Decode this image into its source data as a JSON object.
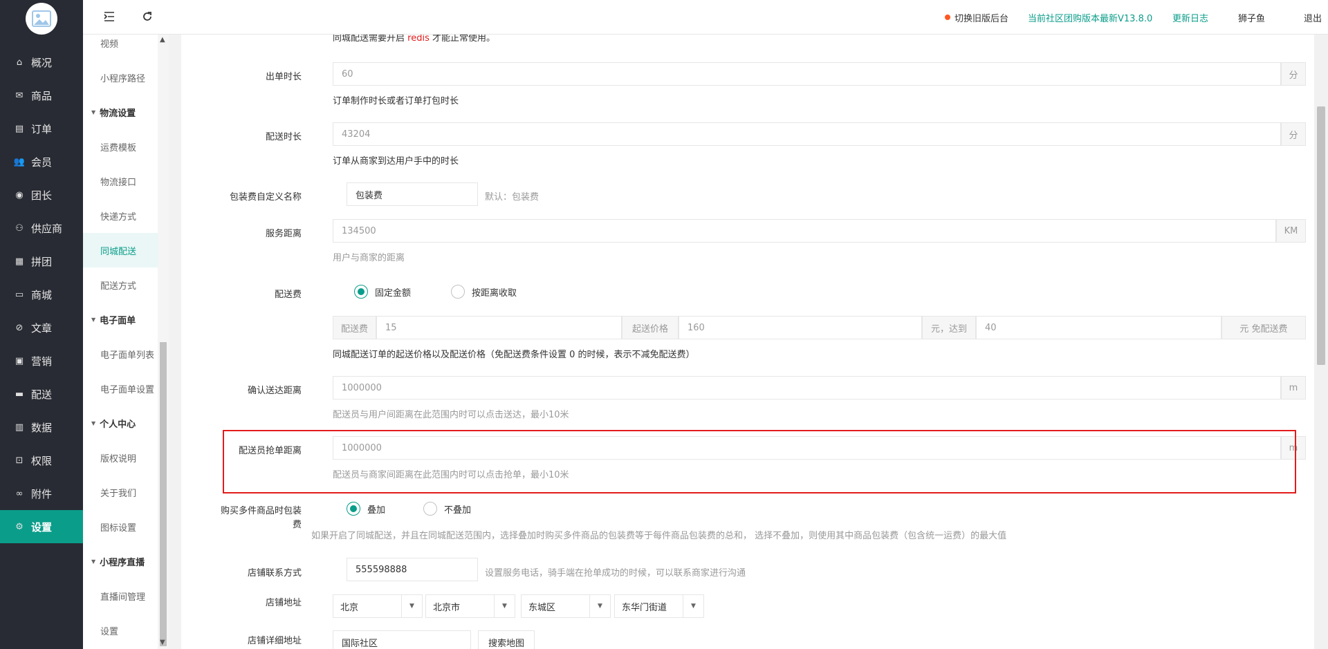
{
  "sidebar": {
    "items": [
      {
        "label": "概况",
        "icon": "home-icon"
      },
      {
        "label": "商品",
        "icon": "envelope-icon"
      },
      {
        "label": "订单",
        "icon": "file-icon"
      },
      {
        "label": "会员",
        "icon": "users-icon"
      },
      {
        "label": "团长",
        "icon": "leader-icon"
      },
      {
        "label": "供应商",
        "icon": "supplier-icon"
      },
      {
        "label": "拼团",
        "icon": "group-icon"
      },
      {
        "label": "商城",
        "icon": "store-icon"
      },
      {
        "label": "文章",
        "icon": "compass-icon"
      },
      {
        "label": "营销",
        "icon": "gift-icon"
      },
      {
        "label": "配送",
        "icon": "truck-icon"
      },
      {
        "label": "数据",
        "icon": "chart-icon"
      },
      {
        "label": "权限",
        "icon": "lock-icon"
      },
      {
        "label": "附件",
        "icon": "link-icon"
      },
      {
        "label": "设置",
        "icon": "gear-icon"
      }
    ],
    "active": "设置"
  },
  "submenu": {
    "items": [
      {
        "label": "视频",
        "type": "item"
      },
      {
        "label": "小程序路径",
        "type": "item"
      },
      {
        "label": "物流设置",
        "type": "group"
      },
      {
        "label": "运费模板",
        "type": "item"
      },
      {
        "label": "物流接口",
        "type": "item"
      },
      {
        "label": "快递方式",
        "type": "item"
      },
      {
        "label": "同城配送",
        "type": "item",
        "active": true
      },
      {
        "label": "配送方式",
        "type": "item"
      },
      {
        "label": "电子面单",
        "type": "group"
      },
      {
        "label": "电子面单列表",
        "type": "item"
      },
      {
        "label": "电子面单设置",
        "type": "item"
      },
      {
        "label": "个人中心",
        "type": "group"
      },
      {
        "label": "版权说明",
        "type": "item"
      },
      {
        "label": "关于我们",
        "type": "item"
      },
      {
        "label": "图标设置",
        "type": "item"
      },
      {
        "label": "小程序直播",
        "type": "group"
      },
      {
        "label": "直播间管理",
        "type": "item"
      },
      {
        "label": "设置",
        "type": "item"
      }
    ]
  },
  "header": {
    "switch_old": "切换旧版后台",
    "version": "当前社区团购版本最新V13.8.0",
    "changelog": "更新日志",
    "username": "狮子鱼",
    "logout": "退出",
    "colors": {
      "accent": "#0a9d8a",
      "dot": "#ff5722"
    }
  },
  "form": {
    "redis_note_pre": "同城配送需要开启",
    "redis_word": "redis",
    "redis_note_post": "才能正常使用。",
    "order_time": {
      "label": "出单时长",
      "value": "60",
      "unit": "分",
      "hint": "订单制作时长或者订单打包时长"
    },
    "delivery_time": {
      "label": "配送时长",
      "value": "43204",
      "unit": "分",
      "hint": "订单从商家到达用户手中的时长"
    },
    "packing_name": {
      "label": "包装费自定义名称",
      "value": "包装费",
      "hint": "默认：包装费"
    },
    "service_distance": {
      "label": "服务距离",
      "value": "134500",
      "unit": "KM",
      "hint": "用户与商家的距离"
    },
    "delivery_fee": {
      "label": "配送费",
      "option_fixed": "固定金额",
      "option_distance": "按距离收取",
      "selected": "固定金额",
      "fee_addon": "配送费",
      "fee_value": "15",
      "start_addon": "起送价格",
      "start_value": "160",
      "reach_addon": "元，达到",
      "reach_value": "40",
      "free_addon": "元 免配送费",
      "hint": "同城配送订单的起送价格以及配送价格（免配送费条件设置 0 的时候，表示不减免配送费）"
    },
    "confirm_distance": {
      "label": "确认送达距离",
      "value": "1000000",
      "unit": "m",
      "hint": "配送员与用户间距离在此范围内时可以点击送达，最小10米"
    },
    "grab_distance": {
      "label": "配送员抢单距离",
      "value": "1000000",
      "unit": "m",
      "hint": "配送员与商家间距离在此范围内时可以点击抢单，最小10米"
    },
    "multi_packing": {
      "label_line1": "购买多件商品时包装",
      "label_line2": "费",
      "option_add": "叠加",
      "option_noadd": "不叠加",
      "selected": "叠加",
      "hint": "如果开启了同城配送，并且在同城配送范围内，选择叠加时购买多件商品的包装费等于每件商品包装费的总和， 选择不叠加，则使用其中商品包装费（包含统一运费）的最大值"
    },
    "contact": {
      "label": "店铺联系方式",
      "value": "555598888",
      "hint": "设置服务电话，骑手端在抢单成功的时候，可以联系商家进行沟通"
    },
    "address": {
      "label": "店铺地址",
      "province": "北京",
      "city": "北京市",
      "district": "东城区",
      "street": "东华门街道"
    },
    "detail_address": {
      "label": "店铺详细地址",
      "value": "国际社区",
      "search_button": "搜索地图"
    }
  }
}
